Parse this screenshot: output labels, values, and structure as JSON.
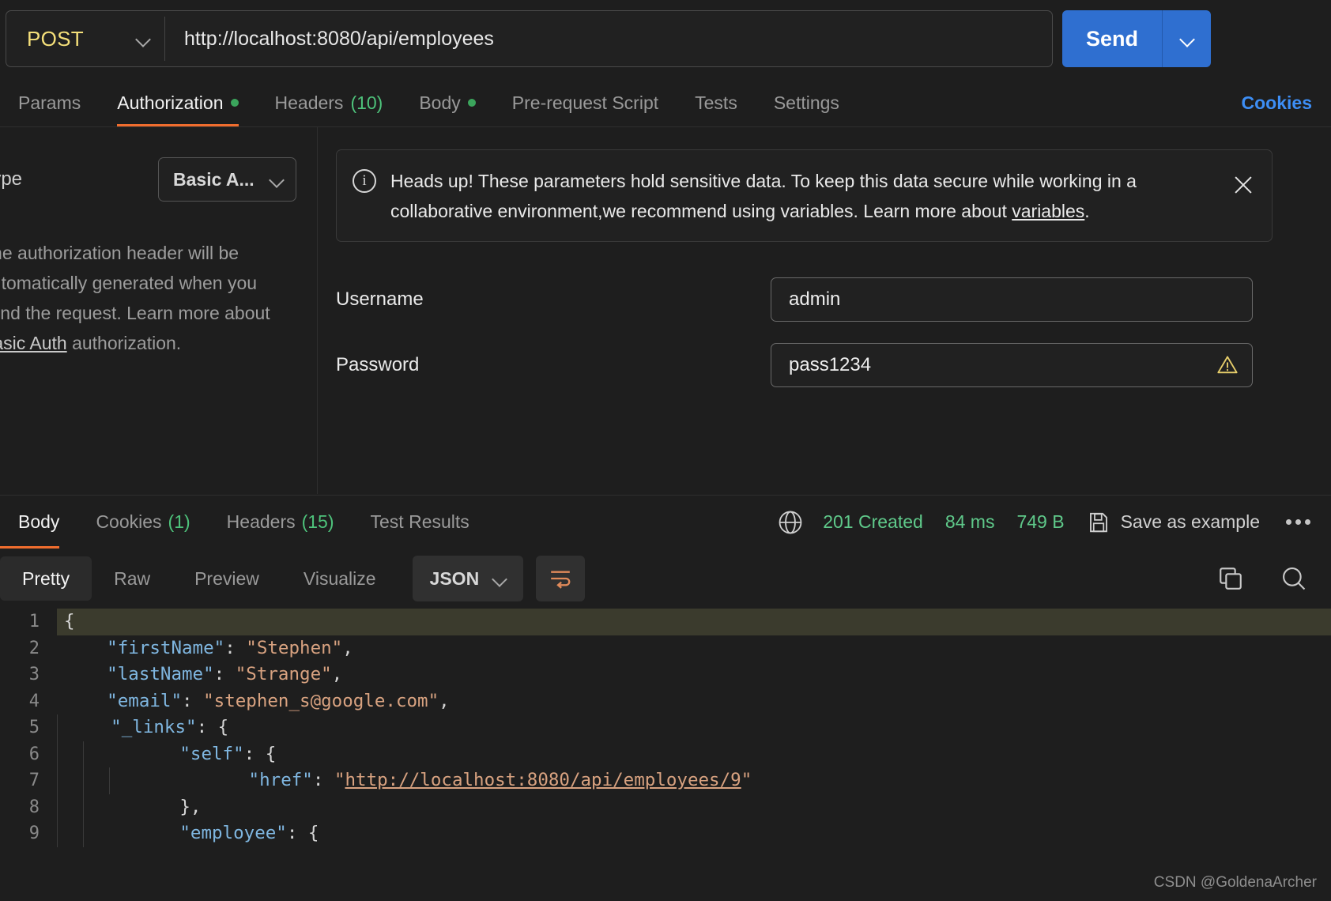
{
  "request": {
    "method": "POST",
    "url": "http://localhost:8080/api/employees",
    "send_label": "Send",
    "tabs": [
      {
        "label": "Params",
        "badge": "",
        "dot": false,
        "active": false
      },
      {
        "label": "Authorization",
        "badge": "",
        "dot": true,
        "active": true
      },
      {
        "label": "Headers",
        "badge": "(10)",
        "dot": false,
        "active": false
      },
      {
        "label": "Body",
        "badge": "",
        "dot": true,
        "active": false
      },
      {
        "label": "Pre-request Script",
        "badge": "",
        "dot": false,
        "active": false
      },
      {
        "label": "Tests",
        "badge": "",
        "dot": false,
        "active": false
      },
      {
        "label": "Settings",
        "badge": "",
        "dot": false,
        "active": false
      }
    ],
    "cookies_link": "Cookies"
  },
  "auth": {
    "type_label": "Type",
    "type_value": "Basic A...",
    "description_part1": "The authorization header will be automatically generated when you send the request. Learn more about ",
    "description_link": "Basic Auth",
    "description_part2": " authorization.",
    "banner": {
      "text_part1": "Heads up! These parameters hold sensitive data. To keep this data secure while working in a collaborative environment,we recommend using variables. Learn more about ",
      "link": "variables",
      "text_part2": "."
    },
    "username_label": "Username",
    "username_value": "admin",
    "password_label": "Password",
    "password_value": "pass1234"
  },
  "response": {
    "tabs": [
      {
        "label": "Body",
        "badge": "",
        "active": true
      },
      {
        "label": "Cookies",
        "badge": "(1)",
        "active": false
      },
      {
        "label": "Headers",
        "badge": "(15)",
        "active": false
      },
      {
        "label": "Test Results",
        "badge": "",
        "active": false
      }
    ],
    "status": "201 Created",
    "time": "84 ms",
    "size": "749 B",
    "save_as_example": "Save as example",
    "format_tabs": [
      {
        "label": "Pretty",
        "active": true
      },
      {
        "label": "Raw",
        "active": false
      },
      {
        "label": "Preview",
        "active": false
      },
      {
        "label": "Visualize",
        "active": false
      }
    ],
    "format_value": "JSON",
    "body_lines": [
      {
        "n": "1",
        "indent": 0,
        "highlight": true,
        "parts": [
          {
            "t": "p",
            "v": "{"
          }
        ]
      },
      {
        "n": "2",
        "indent": 0,
        "highlight": false,
        "parts": [
          {
            "t": "k",
            "v": "    \"firstName\""
          },
          {
            "t": "p",
            "v": ": "
          },
          {
            "t": "s",
            "v": "\"Stephen\""
          },
          {
            "t": "p",
            "v": ","
          }
        ]
      },
      {
        "n": "3",
        "indent": 0,
        "highlight": false,
        "parts": [
          {
            "t": "k",
            "v": "    \"lastName\""
          },
          {
            "t": "p",
            "v": ": "
          },
          {
            "t": "s",
            "v": "\"Strange\""
          },
          {
            "t": "p",
            "v": ","
          }
        ]
      },
      {
        "n": "4",
        "indent": 0,
        "highlight": false,
        "parts": [
          {
            "t": "k",
            "v": "    \"email\""
          },
          {
            "t": "p",
            "v": ": "
          },
          {
            "t": "s",
            "v": "\"stephen_s@google.com\""
          },
          {
            "t": "p",
            "v": ","
          }
        ]
      },
      {
        "n": "5",
        "indent": 1,
        "highlight": false,
        "parts": [
          {
            "t": "k",
            "v": "    \"_links\""
          },
          {
            "t": "p",
            "v": ": {"
          }
        ]
      },
      {
        "n": "6",
        "indent": 2,
        "highlight": false,
        "parts": [
          {
            "t": "k",
            "v": "        \"self\""
          },
          {
            "t": "p",
            "v": ": {"
          }
        ]
      },
      {
        "n": "7",
        "indent": 3,
        "highlight": false,
        "parts": [
          {
            "t": "k",
            "v": "            \"href\""
          },
          {
            "t": "p",
            "v": ": "
          },
          {
            "t": "s",
            "v": "\""
          },
          {
            "t": "link",
            "v": "http://localhost:8080/api/employees/9"
          },
          {
            "t": "s",
            "v": "\""
          }
        ]
      },
      {
        "n": "8",
        "indent": 2,
        "highlight": false,
        "parts": [
          {
            "t": "p",
            "v": "        },"
          }
        ]
      },
      {
        "n": "9",
        "indent": 2,
        "highlight": false,
        "parts": [
          {
            "t": "k",
            "v": "        \"employee\""
          },
          {
            "t": "p",
            "v": ": {"
          }
        ]
      }
    ]
  },
  "watermark": "CSDN @GoldenaArcher"
}
